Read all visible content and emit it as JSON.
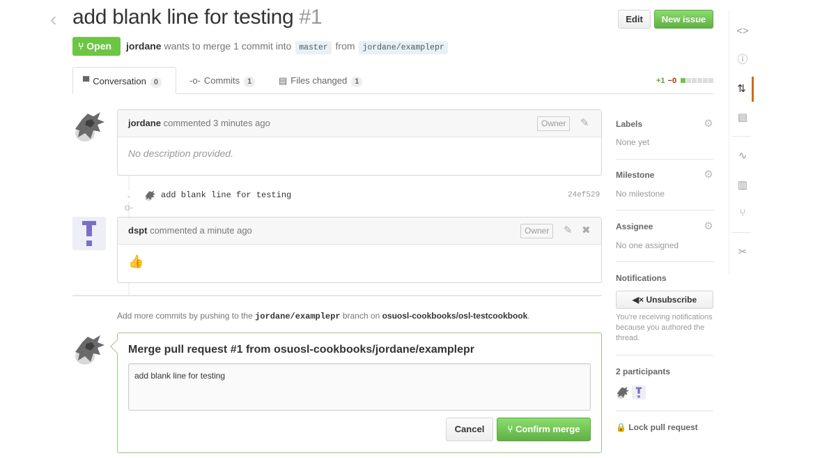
{
  "header": {
    "title": "add blank line for testing",
    "number": "#1",
    "edit_label": "Edit",
    "new_issue_label": "New issue"
  },
  "state": {
    "label": "Open",
    "color": "#6cc644"
  },
  "meta": {
    "author": "jordane",
    "text1": "wants to merge 1 commit into",
    "base": "master",
    "text2": "from",
    "head": "jordane/examplepr"
  },
  "tabs": [
    {
      "label": "Conversation",
      "count": "0"
    },
    {
      "label": "Commits",
      "count": "1"
    },
    {
      "label": "Files changed",
      "count": "1"
    }
  ],
  "diffstat": {
    "additions": "+1",
    "deletions": "−0"
  },
  "comments": [
    {
      "author": "jordane",
      "action": "commented",
      "time": "3 minutes ago",
      "badge": "Owner",
      "body": "No description provided."
    },
    {
      "author": "dspt",
      "action": "commented",
      "time": "a minute ago",
      "badge": "Owner",
      "body": "👍"
    }
  ],
  "commit": {
    "message": "add blank line for testing",
    "sha": "24ef529"
  },
  "push_note": {
    "before": "Add more commits by pushing to the",
    "branch": "jordane/examplepr",
    "middle": "branch on",
    "repo": "osuosl-cookbooks/osl-testcookbook",
    "end": "."
  },
  "merge": {
    "title": "Merge pull request #1 from osuosl-cookbooks/jordane/examplepr",
    "message": "add blank line for testing",
    "cancel_label": "Cancel",
    "confirm_label": "Confirm merge"
  },
  "sidebar": {
    "labels": {
      "title": "Labels",
      "value": "None yet"
    },
    "milestone": {
      "title": "Milestone",
      "value": "No milestone"
    },
    "assignee": {
      "title": "Assignee",
      "value": "No one assigned"
    },
    "notifications": {
      "title": "Notifications",
      "button": "Unsubscribe",
      "reason": "You're receiving notifications because you authored the thread."
    },
    "participants": {
      "title": "2 participants"
    },
    "lock": "Lock pull request"
  },
  "right_nav": [
    "code-icon",
    "issues-icon",
    "pull-requests-icon",
    "wiki-icon",
    "pulse-icon",
    "graphs-icon",
    "network-icon",
    "settings-icon"
  ],
  "colors": {
    "accent_green": "#6cc644",
    "merge_border": "#95c97e",
    "nav_selected": "#d26911"
  }
}
